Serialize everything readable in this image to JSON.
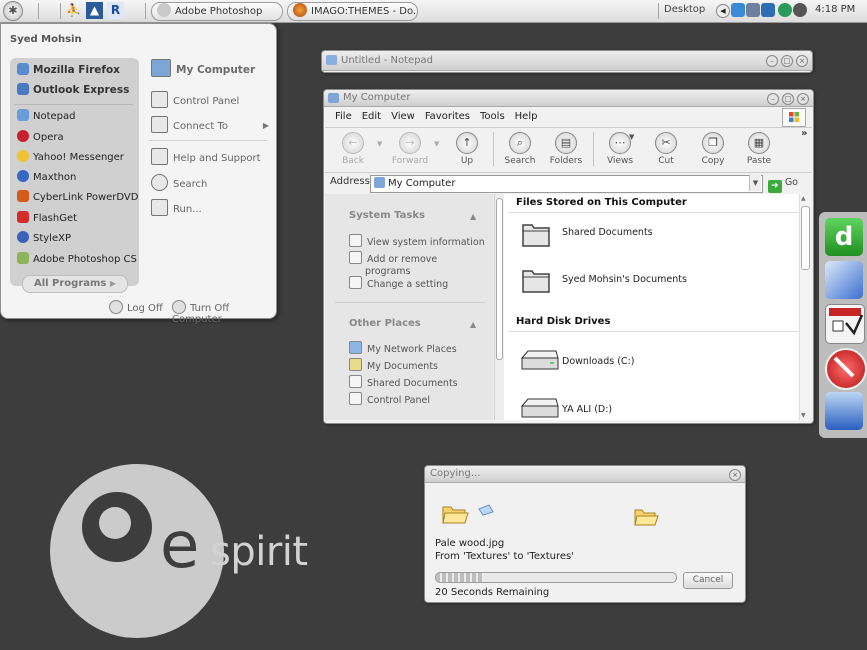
{
  "taskbar": {
    "tasks": [
      {
        "label": "Adobe Photoshop",
        "icon": "photoshop-icon"
      },
      {
        "label": "IMAGO:THEMES - Do...",
        "icon": "firefox-icon"
      }
    ],
    "desktop_label": "Desktop",
    "clock": "4:18 PM"
  },
  "start_menu": {
    "user": "Syed Mohsin",
    "pinned": [
      "Mozilla Firefox",
      "Outlook Express"
    ],
    "recent": [
      "Notepad",
      "Opera",
      "Yahoo! Messenger",
      "Maxthon",
      "CyberLink PowerDVD",
      "FlashGet",
      "StyleXP",
      "Adobe Photoshop CS"
    ],
    "all_programs": "All Programs",
    "right": [
      "My Computer",
      "Control Panel",
      "Connect To",
      "Help and Support",
      "Search",
      "Run..."
    ],
    "log_off": "Log Off",
    "turn_off": "Turn Off Computer"
  },
  "notepad": {
    "title": "Untitled - Notepad"
  },
  "mycomputer": {
    "title": "My Computer",
    "menu": [
      "File",
      "Edit",
      "View",
      "Favorites",
      "Tools",
      "Help"
    ],
    "toolbar": [
      "Back",
      "Forward",
      "Up",
      "Search",
      "Folders",
      "Views",
      "Cut",
      "Copy",
      "Paste"
    ],
    "address_label": "Address",
    "address_value": "My Computer",
    "go": "Go",
    "system_tasks": {
      "title": "System Tasks",
      "items": [
        "View system information",
        "Add or remove programs",
        "Change a setting"
      ]
    },
    "other_places": {
      "title": "Other Places",
      "items": [
        "My Network Places",
        "My Documents",
        "Shared Documents",
        "Control Panel"
      ]
    },
    "groups": {
      "files": {
        "title": "Files Stored on This Computer",
        "items": [
          "Shared Documents",
          "Syed Mohsin's Documents"
        ]
      },
      "drives": {
        "title": "Hard Disk Drives",
        "items": [
          "Downloads (C:)",
          "YA ALI (D:)"
        ]
      }
    }
  },
  "copying": {
    "title": "Copying...",
    "file": "Pale wood.jpg",
    "from_to": "From 'Textures' to 'Textures'",
    "progress": 0.2,
    "remaining": "20 Seconds Remaining",
    "cancel": "Cancel"
  },
  "logo": {
    "e": "e",
    "rest": "spirit"
  }
}
